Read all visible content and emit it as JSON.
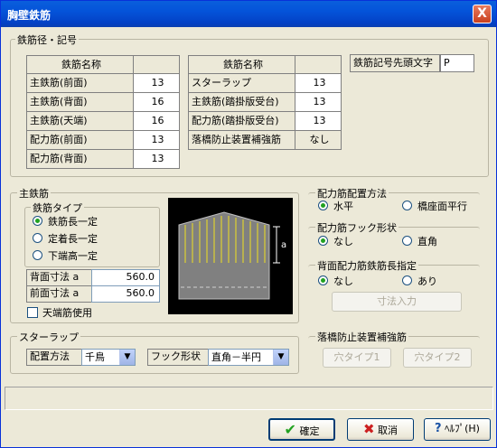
{
  "window": {
    "title": "胸壁鉄筋",
    "close_label": "X"
  },
  "rebar_group": {
    "title": "鉄筋径・記号",
    "table1": {
      "header": "鉄筋名称",
      "rows": [
        {
          "name": "主鉄筋(前面)",
          "value": "13"
        },
        {
          "name": "主鉄筋(背面)",
          "value": "16"
        },
        {
          "name": "主鉄筋(天端)",
          "value": "16"
        },
        {
          "name": "配力筋(前面)",
          "value": "13"
        },
        {
          "name": "配力筋(背面)",
          "value": "13"
        }
      ]
    },
    "table2": {
      "header": "鉄筋名称",
      "rows": [
        {
          "name": "スターラップ",
          "value": "13"
        },
        {
          "name": "主鉄筋(踏掛版受台)",
          "value": "13"
        },
        {
          "name": "配力筋(踏掛版受台)",
          "value": "13"
        },
        {
          "name": "落橋防止装置補強筋",
          "value": "なし"
        }
      ]
    },
    "prefix_label": "鉄筋記号先頭文字",
    "prefix_value": "P"
  },
  "main_rebar": {
    "title": "主鉄筋",
    "type_title": "鉄筋タイプ",
    "options": [
      "鉄筋長一定",
      "定着長一定",
      "下端高一定"
    ],
    "back_label": "背面寸法 a",
    "back_value": "560.0",
    "front_label": "前面寸法 a",
    "front_value": "560.0",
    "top_checkbox_label": "天端筋使用",
    "dimension_label": "a"
  },
  "distribution_layout": {
    "title": "配力筋配置方法",
    "options": [
      "水平",
      "橋座面平行"
    ]
  },
  "distribution_hook": {
    "title": "配力筋フック形状",
    "options": [
      "なし",
      "直角"
    ]
  },
  "back_length": {
    "title": "背面配力筋鉄筋長指定",
    "options": [
      "なし",
      "あり"
    ],
    "button": "寸法入力"
  },
  "stirrup": {
    "title": "スターラップ",
    "layout_label": "配置方法",
    "layout_value": "千鳥",
    "hook_label": "フック形状",
    "hook_value": "直角－半円"
  },
  "bridge_fall": {
    "title": "落橋防止装置補強筋",
    "button1": "穴タイプ1",
    "button2": "穴タイプ2"
  },
  "footer": {
    "ok": "確定",
    "cancel": "取消",
    "help": "ﾍﾙﾌﾟ(H)"
  },
  "colors": {
    "title_bar": "#0453d9",
    "check_green": "#21a121",
    "cancel_red": "#cc2020",
    "diagram_bg": "#000000",
    "rebar_yellow": "#f0e020"
  }
}
